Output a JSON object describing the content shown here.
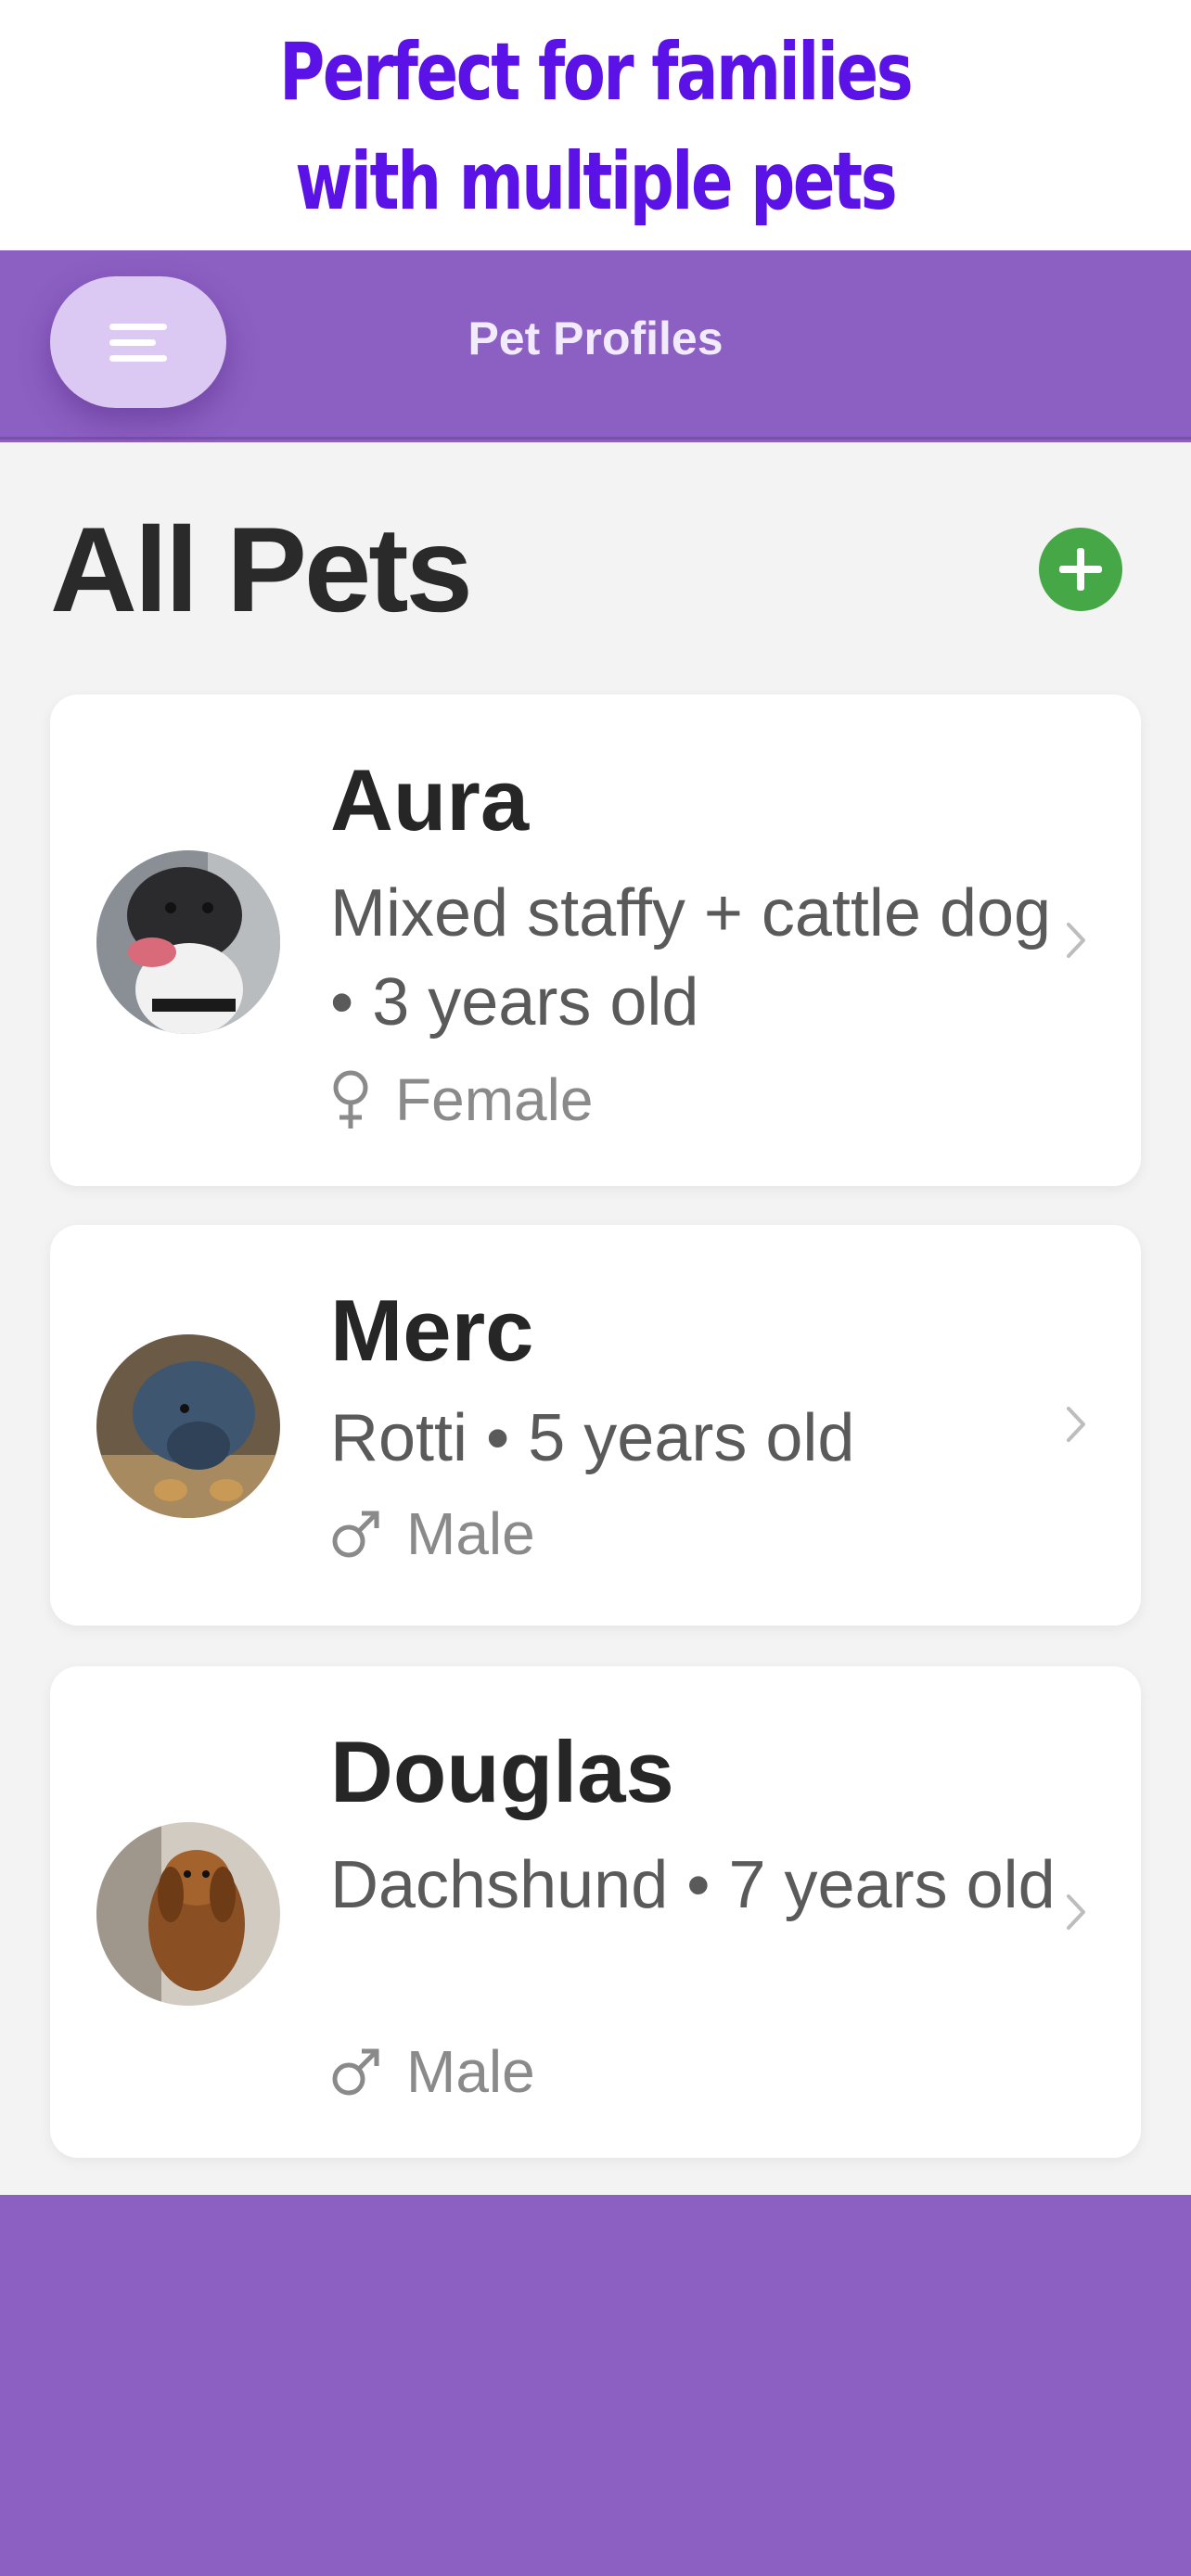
{
  "promo": {
    "line1": "Perfect for families",
    "line2": "with multiple pets"
  },
  "header": {
    "menu_icon": "hamburger-menu-icon",
    "title": "Pet Profiles"
  },
  "main": {
    "title": "All Pets",
    "add_icon": "plus-circle-icon"
  },
  "pets": [
    {
      "name": "Aura",
      "description": "Mixed staffy + cattle dog • 3 years old",
      "gender": "Female",
      "gender_icon": "female-icon"
    },
    {
      "name": "Merc",
      "description": "Rotti • 5 years old",
      "gender": "Male",
      "gender_icon": "male-icon"
    },
    {
      "name": "Douglas",
      "description": "Dachshund • 7 years old",
      "gender": "Male",
      "gender_icon": "male-icon"
    }
  ],
  "colors": {
    "promo_text": "#5b12e6",
    "brand_purple": "#8c5fc2",
    "menu_button": "#dcc9f3",
    "add_button": "#45a745",
    "background": "#f3f3f3"
  }
}
